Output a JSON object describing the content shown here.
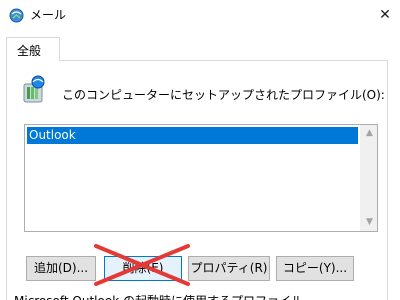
{
  "window": {
    "title": "メール",
    "close_glyph": "✕"
  },
  "tabs": [
    {
      "label": "全般"
    }
  ],
  "main": {
    "description": "このコンピューターにセットアップされたプロファイル(O):",
    "profiles": [
      {
        "name": "Outlook",
        "selected": true
      }
    ]
  },
  "buttons": {
    "add": "追加(D)...",
    "delete": "削除(E)",
    "properties": "プロパティ(R)",
    "copy": "コピー(Y)..."
  },
  "overlay": {
    "crossed_out_button": "delete",
    "color": "#e53935"
  },
  "footer": {
    "text": "Microsoft Outlook の起動時に使用するプロファイル"
  },
  "colors": {
    "selection": "#0078d7",
    "focus_border": "#0078d7"
  }
}
